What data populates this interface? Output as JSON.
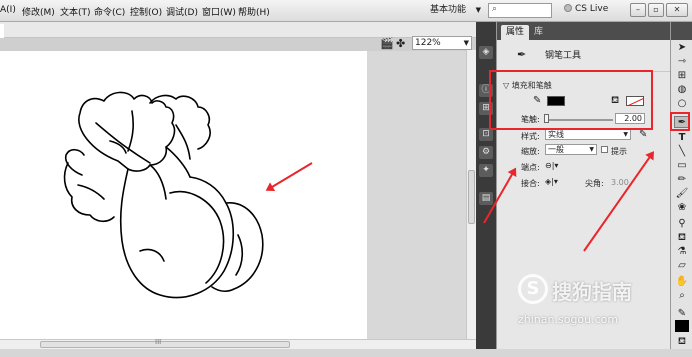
{
  "menubar": {
    "items": [
      "A(I)",
      "修改(M)",
      "文本(T)",
      "命令(C)",
      "控制(O)",
      "调试(D)",
      "窗口(W)",
      "帮助(H)"
    ],
    "workspace": "基本功能",
    "search_placeholder": "",
    "cs_live": "CS Live"
  },
  "toolbar": {
    "zoom": "122%"
  },
  "panel": {
    "tabs": [
      "属性",
      "库"
    ],
    "tool_name": "钢笔工具",
    "fill_stroke_header": "填充和笔触",
    "stroke_label": "笔触:",
    "stroke_value": "2.00",
    "style_label": "样式:",
    "style_value": "实线",
    "scale_label": "缩放:",
    "scale_value": "一般",
    "hint_label": "提示",
    "cap_label": "端点:",
    "join_label": "接合:",
    "miter_label": "尖角:",
    "miter_value": "3.00"
  },
  "colors": {
    "stroke_color": "#000000",
    "annotation": "#e8262c"
  },
  "watermark": {
    "brand": "搜狗指南",
    "url": "zhinan.sogou.com"
  }
}
